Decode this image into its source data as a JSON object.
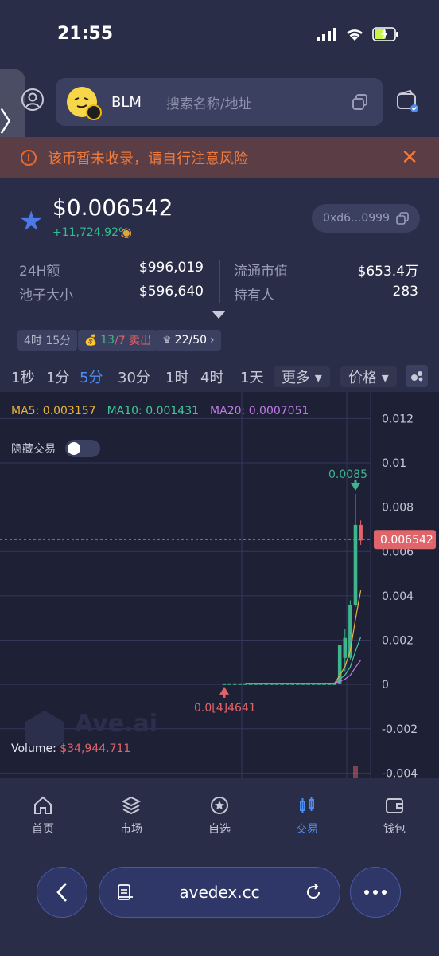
{
  "status": {
    "time": "21:55"
  },
  "header": {
    "token_symbol": "BLM",
    "search_placeholder": "搜索名称/地址"
  },
  "warning": {
    "text": "该币暂未收录，请自行注意风险"
  },
  "token": {
    "price": "$0.006542",
    "change": "+11,724.92%",
    "address": "0xd6...0999",
    "stats": {
      "vol24h_label": "24H额",
      "vol24h_value": "$996,019",
      "pool_label": "池子大小",
      "pool_value": "$596,640",
      "mcap_label": "流通市值",
      "mcap_value": "$653.4万",
      "holders_label": "持有人",
      "holders_value": "283"
    },
    "chips": {
      "age": "4时 15分",
      "buy_count": "13",
      "sell_suffix": "/7 卖出",
      "rank": "22/50"
    }
  },
  "timeframes": [
    "1秒",
    "1分",
    "5分",
    "30分",
    "1时",
    "4时",
    "1天"
  ],
  "timeframe_active": "5分",
  "tf_more": "更多",
  "tf_price": "价格",
  "chart_data": {
    "type": "candlestick",
    "ma": [
      {
        "name": "MA5",
        "value": "0.003157",
        "color": "#e8b43a"
      },
      {
        "name": "MA10",
        "value": "0.001431",
        "color": "#3fc79a"
      },
      {
        "name": "MA20",
        "value": "0.0007051",
        "color": "#c07ae8"
      }
    ],
    "y_ticks": [
      "0.012",
      "0.01",
      "0.008",
      "0.006",
      "0.004",
      "0.002",
      "0",
      "-0.002",
      "-0.004"
    ],
    "y_tick_values": [
      0.012,
      0.01,
      0.008,
      0.006,
      0.004,
      0.002,
      0,
      -0.002,
      -0.004
    ],
    "ylim": [
      -0.0042,
      0.0132
    ],
    "current_price": "0.006542",
    "current_price_value": 0.006542,
    "high_label": "0.0085",
    "high_value": 0.0086,
    "low_label": "0.0[4]4641",
    "low_value": 4.64e-05,
    "candles": [
      {
        "o": 4.64e-05,
        "h": 4.64e-05,
        "l": 4.64e-05,
        "c": 4.64e-05
      },
      {
        "o": 5e-05,
        "h": 5e-05,
        "l": 5e-05,
        "c": 5e-05
      },
      {
        "o": 5e-05,
        "h": 5e-05,
        "l": 5e-05,
        "c": 5e-05
      },
      {
        "o": 5e-05,
        "h": 5e-05,
        "l": 5e-05,
        "c": 5e-05
      },
      {
        "o": 5e-05,
        "h": 5e-05,
        "l": 5e-05,
        "c": 5e-05
      },
      {
        "o": 5e-05,
        "h": 5e-05,
        "l": 5e-05,
        "c": 5e-05
      },
      {
        "o": 5e-05,
        "h": 5e-05,
        "l": 5e-05,
        "c": 5e-05
      },
      {
        "o": 5e-05,
        "h": 5e-05,
        "l": 5e-05,
        "c": 5e-05
      },
      {
        "o": 5e-05,
        "h": 5e-05,
        "l": 5e-05,
        "c": 5e-05
      },
      {
        "o": 5e-05,
        "h": 5e-05,
        "l": 5e-05,
        "c": 5e-05
      },
      {
        "o": 5e-05,
        "h": 5e-05,
        "l": 5e-05,
        "c": 5e-05
      },
      {
        "o": 5e-05,
        "h": 5e-05,
        "l": 5e-05,
        "c": 5e-05
      },
      {
        "o": 5e-05,
        "h": 5e-05,
        "l": 5e-05,
        "c": 5e-05
      },
      {
        "o": 5e-05,
        "h": 5e-05,
        "l": 5e-05,
        "c": 5e-05
      },
      {
        "o": 5e-05,
        "h": 5e-05,
        "l": 5e-05,
        "c": 5e-05
      },
      {
        "o": 5e-05,
        "h": 5e-05,
        "l": 5e-05,
        "c": 5e-05
      },
      {
        "o": 5e-05,
        "h": 5e-05,
        "l": 5e-05,
        "c": 5e-05
      },
      {
        "o": 5e-05,
        "h": 5e-05,
        "l": 5e-05,
        "c": 5e-05
      },
      {
        "o": 5e-05,
        "h": 5e-05,
        "l": 5e-05,
        "c": 5e-05
      },
      {
        "o": 5e-05,
        "h": 5e-05,
        "l": 5e-05,
        "c": 5e-05
      },
      {
        "o": 5e-05,
        "h": 5e-05,
        "l": 5e-05,
        "c": 5e-05
      },
      {
        "o": 5e-05,
        "h": 5e-05,
        "l": 5e-05,
        "c": 5e-05
      },
      {
        "o": 5e-05,
        "h": 0.0018,
        "l": 5e-05,
        "c": 0.0018
      },
      {
        "o": 0.0012,
        "h": 0.0025,
        "l": 0.0006,
        "c": 0.0021
      },
      {
        "o": 0.0012,
        "h": 0.0038,
        "l": 0.0011,
        "c": 0.0036
      },
      {
        "o": 0.0036,
        "h": 0.0086,
        "l": 0.0035,
        "c": 0.0072
      },
      {
        "o": 0.0072,
        "h": 0.0074,
        "l": 0.0063,
        "c": 0.0065
      }
    ],
    "volume_label": "Volume:",
    "volume_value": "$34,944.711",
    "watermark": "Ave.ai"
  },
  "chart_ui": {
    "hide_trades": "隐藏交易"
  },
  "nav": [
    {
      "label": "首页",
      "icon": "home-icon"
    },
    {
      "label": "市场",
      "icon": "layers-icon"
    },
    {
      "label": "自选",
      "icon": "star-circle-icon"
    },
    {
      "label": "交易",
      "icon": "candles-icon"
    },
    {
      "label": "钱包",
      "icon": "wallet-icon"
    }
  ],
  "nav_active": "交易",
  "browser": {
    "url": "avedex.cc"
  },
  "colors": {
    "up": "#3fb58e",
    "down": "#e0656a",
    "accent": "#4d8cf0",
    "warning": "#f07a3c"
  }
}
